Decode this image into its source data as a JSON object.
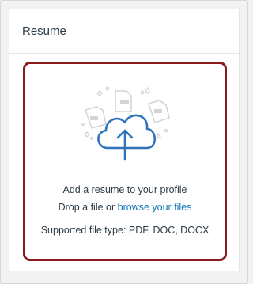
{
  "card": {
    "title": "Resume"
  },
  "dropzone": {
    "add_text": "Add a resume to your profile",
    "drop_text": "Drop a file or",
    "browse_link": "browse your files",
    "supported_text": "Supported file type: PDF, DOC, DOCX"
  },
  "icons": {
    "upload": "cloud-upload-icon",
    "documents": "document-icon"
  },
  "colors": {
    "highlight_border": "#8b1a1a",
    "link": "#0f78b9",
    "cloud": "#2f73b8"
  }
}
